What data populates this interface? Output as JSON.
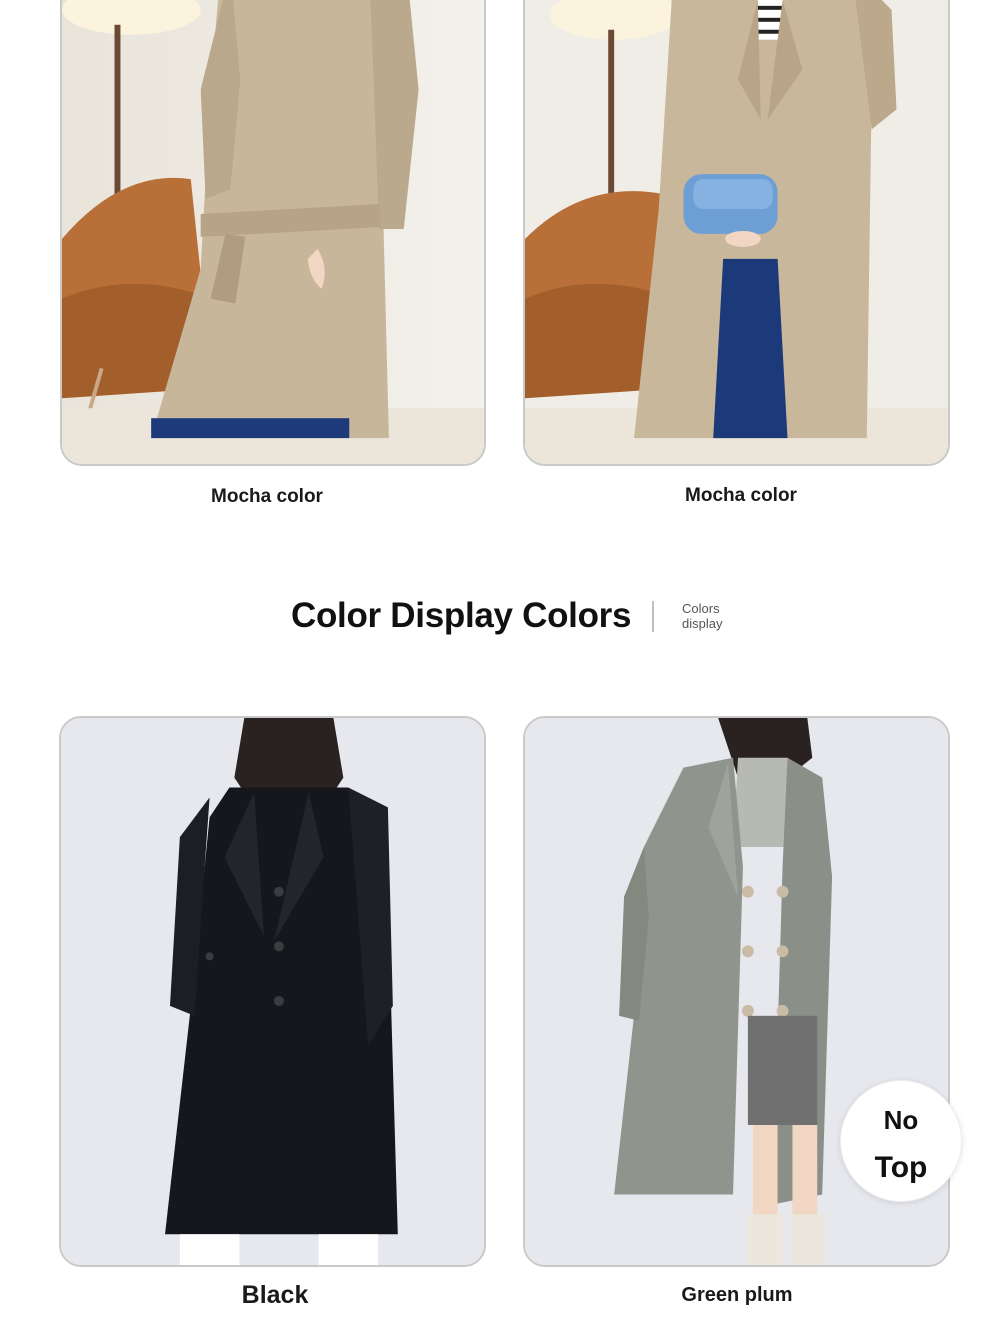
{
  "products": [
    {
      "caption": "Mocha color",
      "color_name": "Mocha color",
      "swatch": "#c8b69a"
    },
    {
      "caption": "Mocha color",
      "color_name": "Mocha color",
      "swatch": "#c8b69a"
    },
    {
      "caption": "Black",
      "color_name": "Black",
      "swatch": "#15171c"
    },
    {
      "caption": "Green plum",
      "color_name": "Green plum",
      "swatch": "#8f948c"
    }
  ],
  "section": {
    "title": "Color Display Colors",
    "subtitle_line1": "Colors",
    "subtitle_line2": "display"
  },
  "floating_button": {
    "line1": "No",
    "line2": "Top"
  },
  "colors": {
    "card_border": "#c9c9c9",
    "background": "#ffffff",
    "text": "#111111"
  }
}
